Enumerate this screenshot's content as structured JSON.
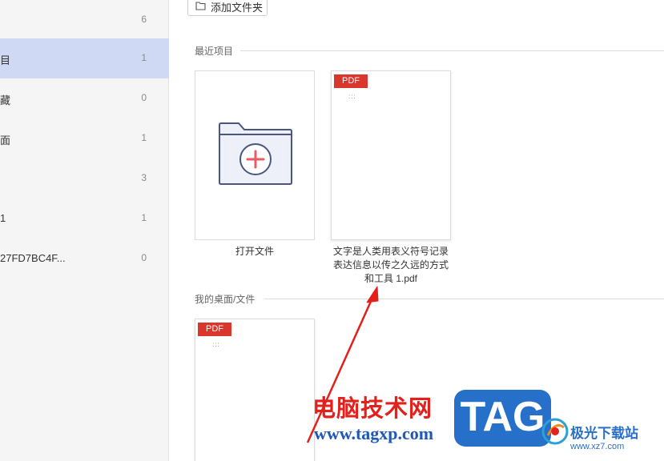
{
  "sidebar": {
    "items": [
      {
        "label": "",
        "count": "6"
      },
      {
        "label": "目",
        "count": "1"
      },
      {
        "label": "藏",
        "count": "0"
      },
      {
        "label": "面",
        "count": "1"
      },
      {
        "label": "",
        "count": "3"
      },
      {
        "label": "1",
        "count": "1"
      },
      {
        "label": "27FD7BC4F...",
        "count": "0"
      }
    ]
  },
  "toolbar": {
    "add_folder_label": "添加文件夹"
  },
  "sections": {
    "recent_title": "最近项目",
    "desktop_title": "我的桌面/文件"
  },
  "recent_items": [
    {
      "caption": "打开文件",
      "icon": "folder-plus-icon"
    },
    {
      "caption_lines": [
        "文字是人类用表义符号记录",
        "表达信息以传之久远的方式",
        "和工具 1.pdf"
      ],
      "badge": "PDF",
      "dots": ":::"
    }
  ],
  "desktop_items": [
    {
      "badge": "PDF",
      "dots": ":::"
    }
  ],
  "watermark": {
    "brand_cn": "电脑技术网",
    "url": "www.tagxp.com",
    "tag": "TAG",
    "site_cn": "极光下载站",
    "site_url": "www.xz7.com"
  },
  "colors": {
    "sidebar_active": "#cfd9f4",
    "pdf_badge": "#d9372b",
    "arrow": "#e3201b",
    "tag_blue": "#2670ca"
  }
}
